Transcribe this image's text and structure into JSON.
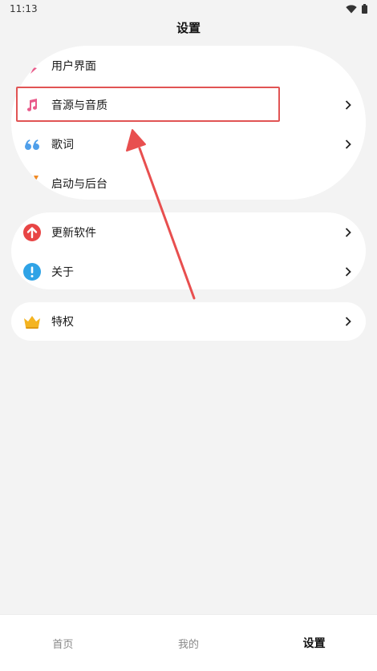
{
  "status_bar": {
    "time": "11:13"
  },
  "header": {
    "title": "设置"
  },
  "groups": [
    {
      "items": [
        {
          "label": "用户界面",
          "icon": "palette-icon"
        },
        {
          "label": "音源与音质",
          "icon": "music-note-icon"
        },
        {
          "label": "歌词",
          "icon": "quote-icon"
        },
        {
          "label": "启动与后台",
          "icon": "rocket-icon"
        }
      ]
    },
    {
      "items": [
        {
          "label": "更新软件",
          "icon": "update-arrow-icon"
        },
        {
          "label": "关于",
          "icon": "info-icon"
        }
      ]
    },
    {
      "items": [
        {
          "label": "特权",
          "icon": "crown-icon"
        }
      ]
    }
  ],
  "bottom_nav": {
    "items": [
      {
        "label": "首页"
      },
      {
        "label": "我的"
      },
      {
        "label": "设置"
      }
    ],
    "active": "设置"
  },
  "colors": {
    "highlight": "#e15454",
    "update_red": "#e84545",
    "info_blue": "#2fa3e6",
    "lyric_blue": "#4f9fea",
    "music_pink": "#e95a8a",
    "crown_gold": "#f4b421",
    "rocket_orange": "#f08a24"
  }
}
